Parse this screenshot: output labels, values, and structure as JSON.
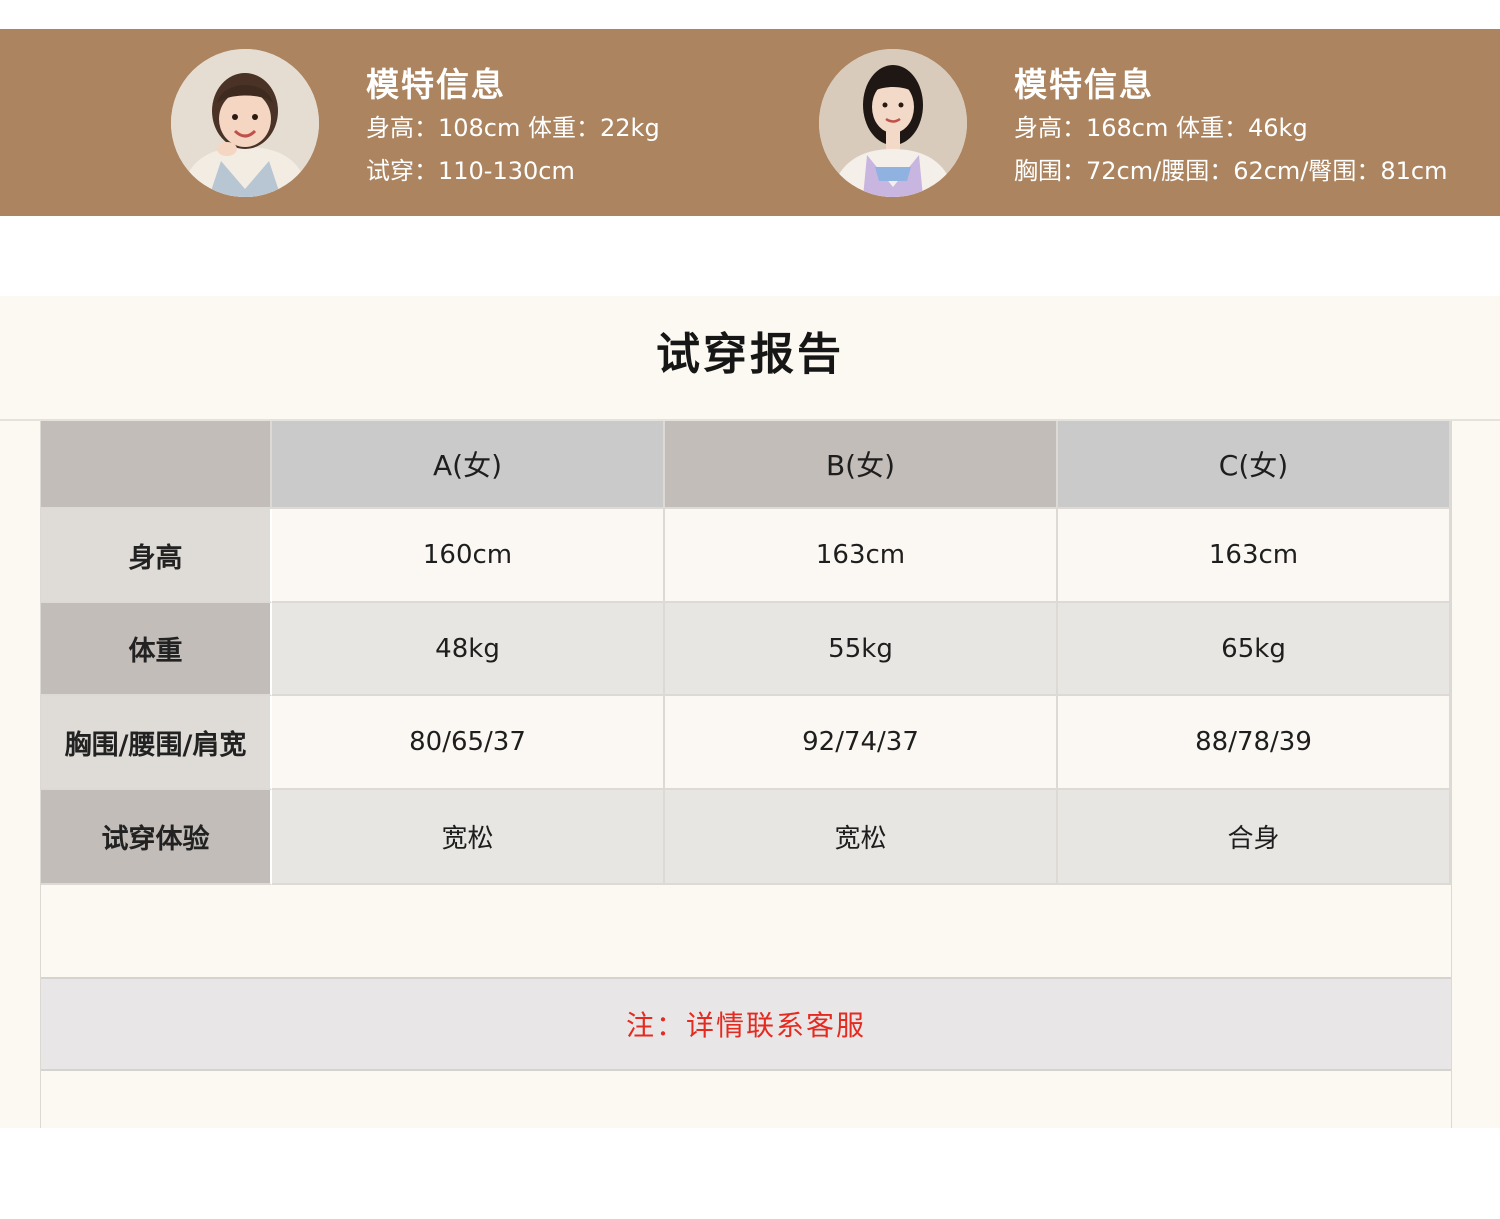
{
  "colors": {
    "banner": "#ac8560",
    "report_background": "#fcf8f2",
    "note_text": "#e52a1f",
    "header_light": "#cacaca",
    "header_dark": "#c2bdb9"
  },
  "models": [
    {
      "title": "模特信息",
      "line1": "身高：108cm  体重：22kg",
      "line2": "试穿：110-130cm",
      "avatar_icon": "child-model-avatar"
    },
    {
      "title": "模特信息",
      "line1": "身高：168cm  体重：46kg",
      "line2": "胸围：72cm/腰围：62cm/臀围：81cm",
      "avatar_icon": "adult-model-avatar"
    }
  ],
  "report": {
    "title": "试穿报告",
    "columns": [
      "",
      "A(女)",
      "B(女)",
      "C(女)"
    ],
    "rows": [
      {
        "label": "身高",
        "values": [
          "160cm",
          "163cm",
          "163cm"
        ]
      },
      {
        "label": "体重",
        "values": [
          "48kg",
          "55kg",
          "65kg"
        ]
      },
      {
        "label": "胸围/腰围/肩宽",
        "values": [
          "80/65/37",
          "92/74/37",
          "88/78/39"
        ]
      },
      {
        "label": "试穿体验",
        "values": [
          "宽松",
          "宽松",
          "合身"
        ]
      }
    ],
    "note": "注：详情联系客服"
  }
}
